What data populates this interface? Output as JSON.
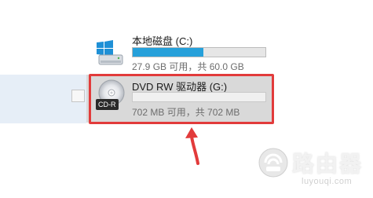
{
  "drives": [
    {
      "name": "本地磁盘 (C:)",
      "size_text": "27.9 GB 可用，共 60.0 GB",
      "used_fraction": 0.535,
      "bar_color": "#26a0da",
      "icon": "windows-hdd-icon"
    },
    {
      "name": "DVD RW 驱动器 (G:)",
      "size_text": "702 MB 可用，共 702 MB",
      "used_fraction": 0,
      "badge": "CD-R",
      "icon": "cd-disc-icon",
      "selected": true
    }
  ],
  "highlight_color": "#e23b3b",
  "watermark": {
    "title": "路由器",
    "url": "luyouqi.com"
  }
}
